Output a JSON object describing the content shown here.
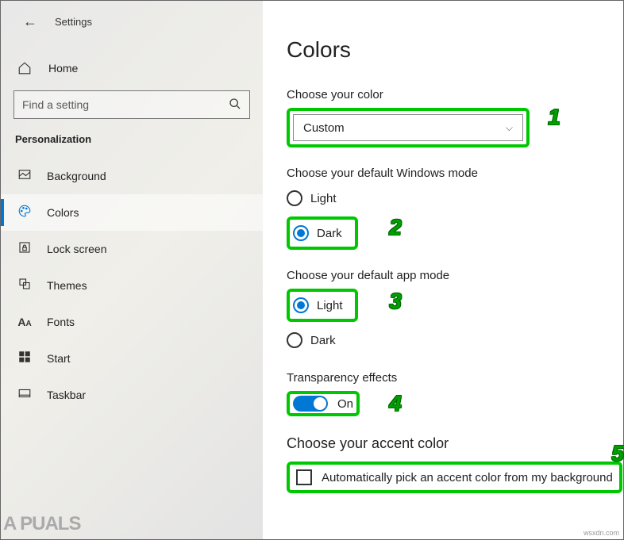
{
  "header": {
    "title": "Settings"
  },
  "sidebar": {
    "home": "Home",
    "search_placeholder": "Find a setting",
    "section": "Personalization",
    "items": [
      {
        "label": "Background"
      },
      {
        "label": "Colors"
      },
      {
        "label": "Lock screen"
      },
      {
        "label": "Themes"
      },
      {
        "label": "Fonts"
      },
      {
        "label": "Start"
      },
      {
        "label": "Taskbar"
      }
    ]
  },
  "main": {
    "title": "Colors",
    "choose_color_label": "Choose your color",
    "choose_color_value": "Custom",
    "windows_mode_label": "Choose your default Windows mode",
    "windows_mode_light": "Light",
    "windows_mode_dark": "Dark",
    "app_mode_label": "Choose your default app mode",
    "app_mode_light": "Light",
    "app_mode_dark": "Dark",
    "transparency_label": "Transparency effects",
    "transparency_value": "On",
    "accent_header": "Choose your accent color",
    "accent_auto": "Automatically pick an accent color from my background"
  },
  "annotations": {
    "n1": "1",
    "n2": "2",
    "n3": "3",
    "n4": "4",
    "n5": "5"
  },
  "watermark_left": "A  PUALS",
  "watermark_right": "wsxdn.com"
}
